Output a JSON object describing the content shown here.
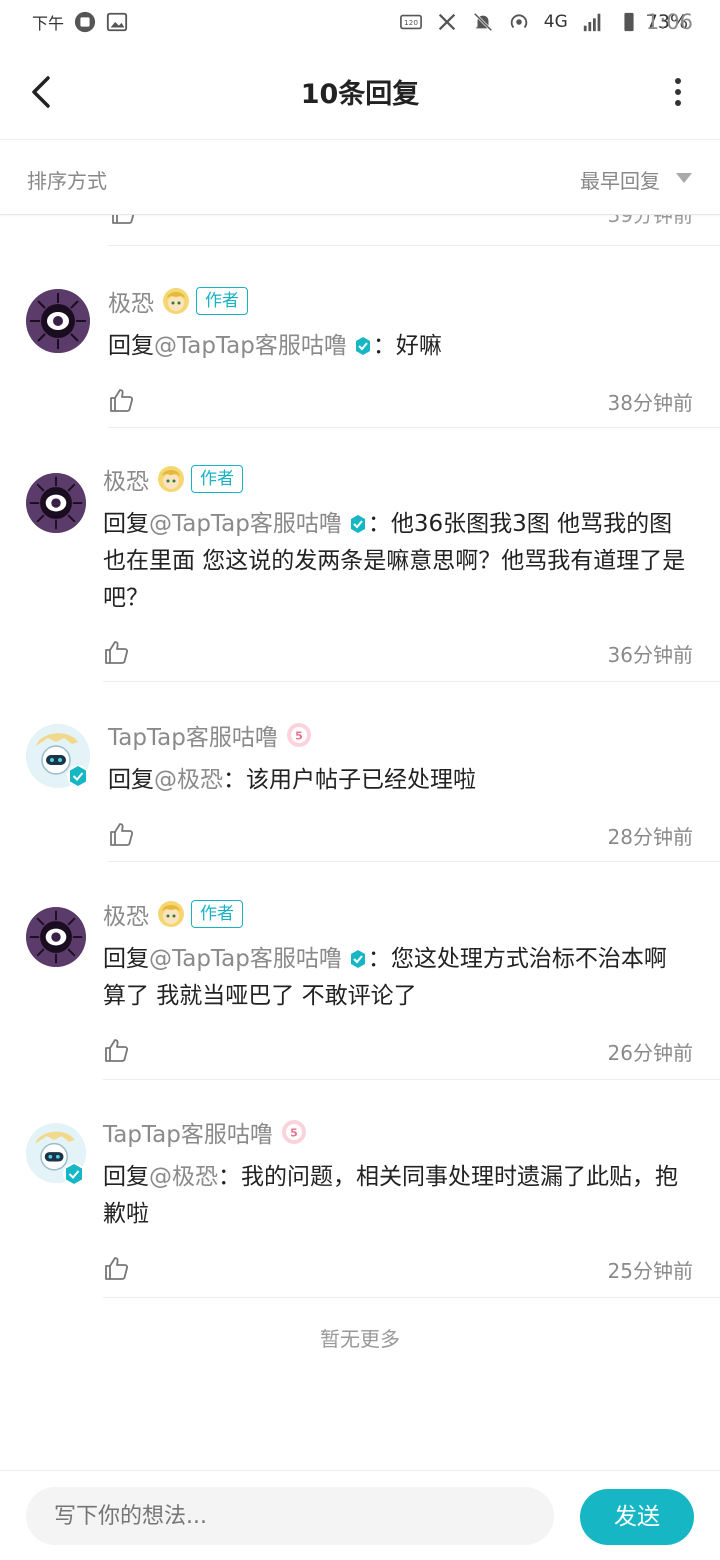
{
  "status_bar": {
    "ampm": "下午",
    "time": "1:06",
    "battery": "73%",
    "network": "4G"
  },
  "header": {
    "title": "10条回复"
  },
  "sort": {
    "label": "排序方式",
    "value": "最早回复"
  },
  "partial_item": {
    "time": "39分钟前"
  },
  "comments": [
    {
      "name": "极恐",
      "tag": "作者",
      "prefix": "回复",
      "mention": "@TapTap客服咕噜",
      "colon": "：",
      "body": "好嘛",
      "time": "38分钟前"
    },
    {
      "name": "极恐",
      "tag": "作者",
      "prefix": "回复",
      "mention": "@TapTap客服咕噜",
      "colon": "：",
      "body": "他36张图我3图 他骂我的图也在里面 您这说的发两条是嘛意思啊？他骂我有道理了是吧？",
      "time": "36分钟前"
    },
    {
      "name": "TapTap客服咕噜",
      "prefix": "回复",
      "mention": "@极恐",
      "colon": "：",
      "body": "该用户帖子已经处理啦",
      "time": "28分钟前"
    },
    {
      "name": "极恐",
      "tag": "作者",
      "prefix": "回复",
      "mention": "@TapTap客服咕噜",
      "colon": "：",
      "body": "您这处理方式治标不治本啊 算了 我就当哑巴了 不敢评论了",
      "time": "26分钟前"
    },
    {
      "name": "TapTap客服咕噜",
      "prefix": "回复",
      "mention": "@极恐",
      "colon": "：",
      "body": "我的问题，相关同事处理时遗漏了此贴，抱歉啦",
      "time": "25分钟前"
    }
  ],
  "no_more": "暂无更多",
  "composer": {
    "placeholder": "写下你的想法...",
    "send_label": "发送"
  },
  "colors": {
    "accent": "#16b6c4",
    "muted": "#8a8a8a"
  }
}
